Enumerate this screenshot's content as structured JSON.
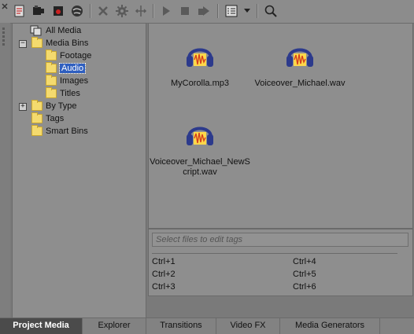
{
  "toolbar": {
    "buttons": [
      {
        "icon": "close-pin-icon"
      },
      {
        "icon": "import-media-icon"
      },
      {
        "icon": "capture-video-icon"
      },
      {
        "icon": "get-media-from-disc-icon"
      },
      {
        "icon": "get-media-from-web-icon"
      },
      {
        "icon": "remove-media-icon"
      },
      {
        "icon": "media-fx-icon"
      },
      {
        "icon": "media-generators-properties-icon"
      },
      {
        "icon": "play-icon"
      },
      {
        "icon": "stop-icon"
      },
      {
        "icon": "auto-preview-icon"
      },
      {
        "icon": "views-icon"
      },
      {
        "icon": "dropdown-arrow-icon"
      },
      {
        "icon": "search-icon"
      }
    ]
  },
  "tree": {
    "nodes": [
      {
        "label": "All Media"
      },
      {
        "label": "Media Bins",
        "expander": "−"
      },
      {
        "label": "Footage"
      },
      {
        "label": "Audio"
      },
      {
        "label": "Images"
      },
      {
        "label": "Titles"
      },
      {
        "label": "By Type",
        "expander": "+"
      },
      {
        "label": "Tags"
      },
      {
        "label": "Smart Bins"
      }
    ]
  },
  "media": {
    "files": [
      {
        "name": "MyCorolla.mp3",
        "icon": "audio-headphones-icon"
      },
      {
        "name": "Voiceover_Michael.wav",
        "icon": "audio-headphones-icon"
      },
      {
        "name": "Voiceover_Michael_NewScript.wav",
        "name_line1": "Voiceover_Michael_NewS",
        "name_line2": "cript.wav",
        "icon": "audio-headphones-icon"
      }
    ]
  },
  "tags": {
    "placeholder": "Select files to edit tags",
    "shortcuts": [
      "Ctrl+1",
      "Ctrl+2",
      "Ctrl+3",
      "Ctrl+4",
      "Ctrl+5",
      "Ctrl+6"
    ]
  },
  "tabs": [
    {
      "label": "Project Media",
      "active": true
    },
    {
      "label": "Explorer"
    },
    {
      "label": "Transitions"
    },
    {
      "label": "Video FX"
    },
    {
      "label": "Media Generators"
    }
  ],
  "colors": {
    "selection": "#2f5fbf",
    "folder": "#f4da6e",
    "headphones": "#2c3a8c",
    "waveform": "#e8a020"
  }
}
